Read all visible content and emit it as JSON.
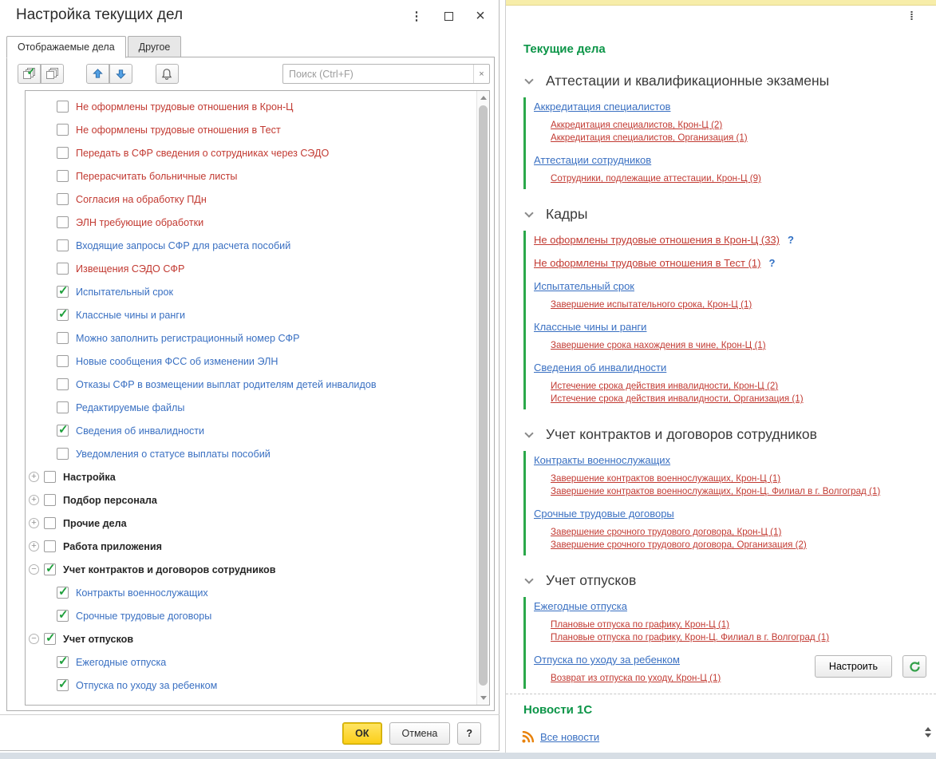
{
  "colors": {
    "accent_yellow": "#FBCE17",
    "link_blue": "#3A70C2",
    "link_red": "#C23A32",
    "title_green": "#0C9548",
    "section_bar_green": "#2BA84A",
    "top_strip_yellow": "#F7EDA9"
  },
  "icons": {
    "window_menu": "vertical-dots",
    "window_maximize": "square-outline",
    "window_close": "×",
    "check_all": "stacked-pages-with-green-check",
    "uncheck_all": "stacked-pages",
    "move_up": "blue-arrow-up",
    "move_down": "blue-arrow-down",
    "notifications": "bell",
    "search_clear": "x",
    "section_chevron": "chevron-down",
    "help_mark": "?",
    "refresh": "green-circular-arrow",
    "rss": "orange-rss-waves",
    "scroll_spinner": "up-down-triangles"
  },
  "dialog": {
    "title": "Настройка текущих дел",
    "tabs": [
      {
        "label": "Отображаемые дела",
        "active": true
      },
      {
        "label": "Другое",
        "active": false
      }
    ],
    "toolbar": {
      "search_placeholder": "Поиск (Ctrl+F)",
      "search_value": "",
      "clear_glyph": "×"
    },
    "tree": [
      {
        "type": "item",
        "label": "Не оформлены трудовые отношения в Крон-Ц",
        "color": "red",
        "checked": false
      },
      {
        "type": "item",
        "label": "Не оформлены трудовые отношения в Тест",
        "color": "red",
        "checked": false
      },
      {
        "type": "item",
        "label": "Передать в СФР сведения о сотрудниках через СЭДО",
        "color": "red",
        "checked": false
      },
      {
        "type": "item",
        "label": "Перерасчитать больничные листы",
        "color": "red",
        "checked": false
      },
      {
        "type": "item",
        "label": "Согласия на обработку ПДн",
        "color": "red",
        "checked": false
      },
      {
        "type": "item",
        "label": "ЭЛН требующие обработки",
        "color": "red",
        "checked": false
      },
      {
        "type": "item",
        "label": "Входящие запросы СФР для расчета пособий",
        "color": "blue",
        "checked": false
      },
      {
        "type": "item",
        "label": "Извещения СЭДО СФР",
        "color": "red",
        "checked": false
      },
      {
        "type": "item",
        "label": "Испытательный срок",
        "color": "blue",
        "checked": true
      },
      {
        "type": "item",
        "label": "Классные чины и ранги",
        "color": "blue",
        "checked": true
      },
      {
        "type": "item",
        "label": "Можно заполнить регистрационный номер СФР",
        "color": "blue",
        "checked": false
      },
      {
        "type": "item",
        "label": "Новые сообщения ФСС об изменении ЭЛН",
        "color": "blue",
        "checked": false
      },
      {
        "type": "item",
        "label": "Отказы СФР в возмещении выплат родителям детей инвалидов",
        "color": "blue",
        "checked": false
      },
      {
        "type": "item",
        "label": "Редактируемые файлы",
        "color": "blue",
        "checked": false
      },
      {
        "type": "item",
        "label": "Сведения об инвалидности",
        "color": "blue",
        "checked": true
      },
      {
        "type": "item",
        "label": "Уведомления о статусе выплаты пособий",
        "color": "blue",
        "checked": false
      },
      {
        "type": "group",
        "label": "Настройка",
        "expanded": false,
        "checked": false
      },
      {
        "type": "group",
        "label": "Подбор персонала",
        "expanded": false,
        "checked": false
      },
      {
        "type": "group",
        "label": "Прочие дела",
        "expanded": false,
        "checked": false
      },
      {
        "type": "group",
        "label": "Работа приложения",
        "expanded": false,
        "checked": false
      },
      {
        "type": "group",
        "label": "Учет контрактов и договоров сотрудников",
        "expanded": true,
        "checked": true
      },
      {
        "type": "item",
        "label": "Контракты военнослужащих",
        "color": "blue",
        "checked": true
      },
      {
        "type": "item",
        "label": "Срочные трудовые договоры",
        "color": "blue",
        "checked": true
      },
      {
        "type": "group",
        "label": "Учет отпусков",
        "expanded": true,
        "checked": true
      },
      {
        "type": "item",
        "label": "Ежегодные отпуска",
        "color": "blue",
        "checked": true
      },
      {
        "type": "item",
        "label": "Отпуска по уходу за ребенком",
        "color": "blue",
        "checked": true
      }
    ],
    "buttons": [
      {
        "label": "ОК",
        "primary": true
      },
      {
        "label": "Отмена",
        "primary": false
      },
      {
        "label": "?",
        "primary": false
      }
    ]
  },
  "panel": {
    "title": "Текущие дела",
    "sections": [
      {
        "title": "Аттестации и квалификационные экзамены",
        "groups": [
          {
            "title": "Аккредитация специалистов",
            "color": "blue",
            "help": false,
            "items": [
              "Аккредитация специалистов, Крон-Ц (2)",
              "Аккредитация специалистов, Организация (1)"
            ]
          },
          {
            "title": "Аттестации сотрудников",
            "color": "blue",
            "help": false,
            "items": [
              "Сотрудники, подлежащие аттестации, Крон-Ц (9)"
            ]
          }
        ]
      },
      {
        "title": "Кадры",
        "groups": [
          {
            "title": "Не оформлены трудовые отношения в Крон-Ц (33)",
            "color": "red",
            "help": true,
            "items": []
          },
          {
            "title": "Не оформлены трудовые отношения в Тест (1)",
            "color": "red",
            "help": true,
            "items": []
          },
          {
            "title": "Испытательный срок",
            "color": "blue",
            "help": false,
            "items": [
              "Завершение испытательного срока, Крон-Ц (1)"
            ]
          },
          {
            "title": "Классные чины и ранги",
            "color": "blue",
            "help": false,
            "items": [
              "Завершение срока нахождения в чине, Крон-Ц (1)"
            ]
          },
          {
            "title": "Сведения об инвалидности",
            "color": "blue",
            "help": false,
            "items": [
              "Истечение срока действия инвалидности, Крон-Ц (2)",
              "Истечение срока действия инвалидности, Организация (1)"
            ]
          }
        ]
      },
      {
        "title": "Учет контрактов и договоров сотрудников",
        "groups": [
          {
            "title": "Контракты военнослужащих",
            "color": "blue",
            "help": false,
            "items": [
              "Завершение контрактов военнослужащих, Крон-Ц (1)",
              "Завершение контрактов военнослужащих, Крон-Ц. Филиал в г. Волгоград (1)"
            ]
          },
          {
            "title": "Срочные трудовые договоры",
            "color": "blue",
            "help": false,
            "items": [
              "Завершение срочного трудового договора, Крон-Ц (1)",
              "Завершение срочного трудового договора, Организация (2)"
            ]
          }
        ]
      },
      {
        "title": "Учет отпусков",
        "groups": [
          {
            "title": "Ежегодные отпуска",
            "color": "blue",
            "help": false,
            "items": [
              "Плановые отпуска по графику, Крон-Ц (1)",
              "Плановые отпуска по графику, Крон-Ц. Филиал в г. Волгоград (1)"
            ]
          },
          {
            "title": "Отпуска по уходу за ребенком",
            "color": "blue",
            "help": false,
            "items": [
              "Возврат из отпуска по уходу, Крон-Ц (1)"
            ]
          }
        ]
      }
    ],
    "help_mark": "?",
    "configure_button": "Настроить",
    "news_title": "Новости 1С",
    "all_news_link": "Все новости"
  }
}
